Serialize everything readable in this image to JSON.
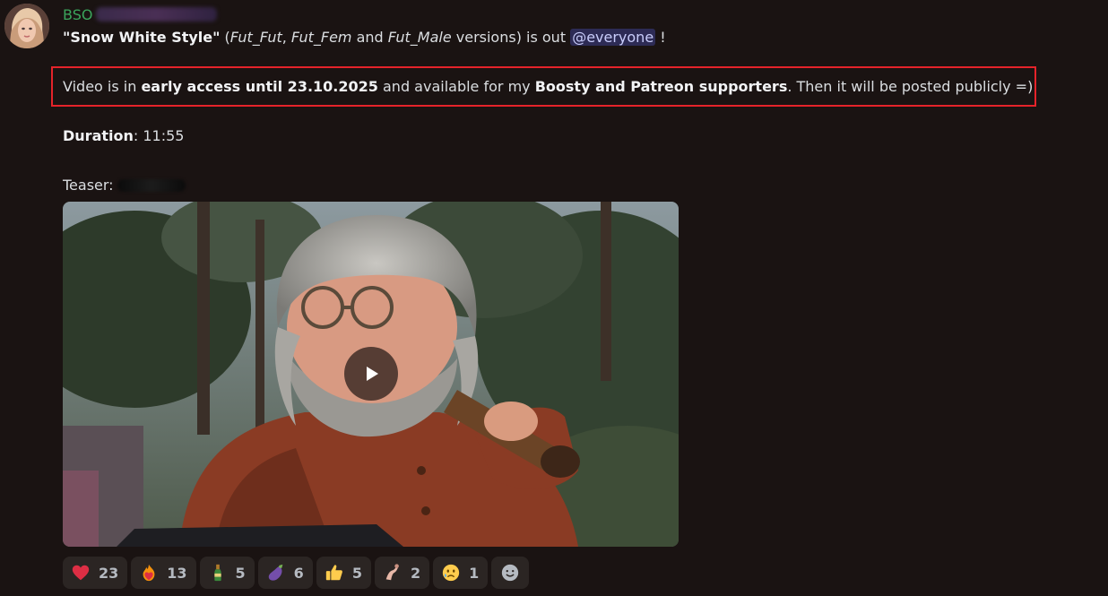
{
  "author": {
    "name": "BSO"
  },
  "message": {
    "line1": {
      "title": "\"Snow White Style\"",
      "open_paren": " (",
      "v1": "Fut_Fut",
      "sep1": ", ",
      "v2": "Fut_Fem",
      "sep2": " and ",
      "v3": "Fut_Male",
      "tail": " versions) is out ",
      "mention": "@everyone",
      "end": " !"
    },
    "line2": {
      "p1": "Video is in ",
      "b1": "early access until 23.10.2025",
      "p2": " and available for my ",
      "b2": "Boosty and Patreon supporters",
      "p3": ". Then it will be posted publicly =)"
    },
    "line3": {
      "label": "Duration",
      "value": ": 11:55"
    },
    "line4": {
      "label": "Teaser:"
    }
  },
  "reactions": [
    {
      "icon": "heart-emoji",
      "count": "23"
    },
    {
      "icon": "heart-on-fire-emoji",
      "count": "13"
    },
    {
      "icon": "bottle-emoji",
      "count": "5"
    },
    {
      "icon": "eggplant-emoji",
      "count": "6"
    },
    {
      "icon": "thumbs-up-emoji",
      "count": "5"
    },
    {
      "icon": "custom-emoji",
      "count": "2"
    },
    {
      "icon": "sad-face-emoji",
      "count": "1"
    }
  ],
  "colors": {
    "background": "#1a1312",
    "username": "#3ba55c",
    "highlight_border": "#e5232a",
    "mention_bg": "#3c3f8a"
  }
}
